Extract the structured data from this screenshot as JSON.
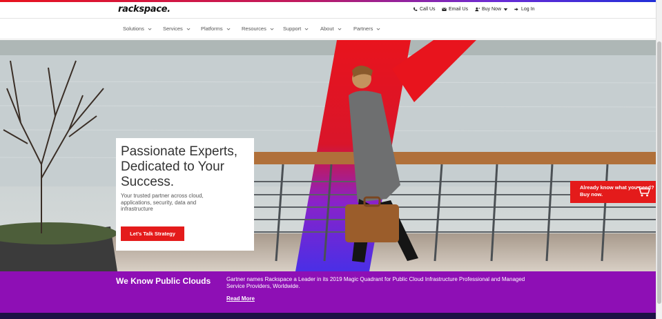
{
  "brand": {
    "logo": "rackspace.",
    "accent": "#e41b1b",
    "purple": "#8e0fb5"
  },
  "utility": {
    "call": {
      "label": "Call Us",
      "icon": "phone-icon"
    },
    "email": {
      "label": "Email Us",
      "icon": "envelope-icon"
    },
    "buy": {
      "label": "Buy Now",
      "icon": "user-plus-icon"
    },
    "login": {
      "label": "Log In",
      "icon": "sign-in-icon"
    }
  },
  "nav": {
    "items": [
      {
        "label": "Solutions"
      },
      {
        "label": "Services"
      },
      {
        "label": "Platforms"
      },
      {
        "label": "Resources"
      },
      {
        "label": "Support"
      },
      {
        "label": "About"
      },
      {
        "label": "Partners"
      }
    ]
  },
  "hero": {
    "title": "Passionate Experts, Dedicated to Your Success.",
    "subtitle": "Your trusted partner across cloud, applications, security, data and infrastructure",
    "cta": "Let's Talk Strategy"
  },
  "side_cta": {
    "label": "Already know what you need? Buy now.",
    "icon": "shopping-cart-icon"
  },
  "banner": {
    "title": "We Know Public Clouds",
    "text": "Gartner names Rackspace a Leader in its 2019 Magic Quadrant for Public Cloud Infrastructure Professional and Managed Service Providers, Worldwide.",
    "link": "Read More"
  }
}
